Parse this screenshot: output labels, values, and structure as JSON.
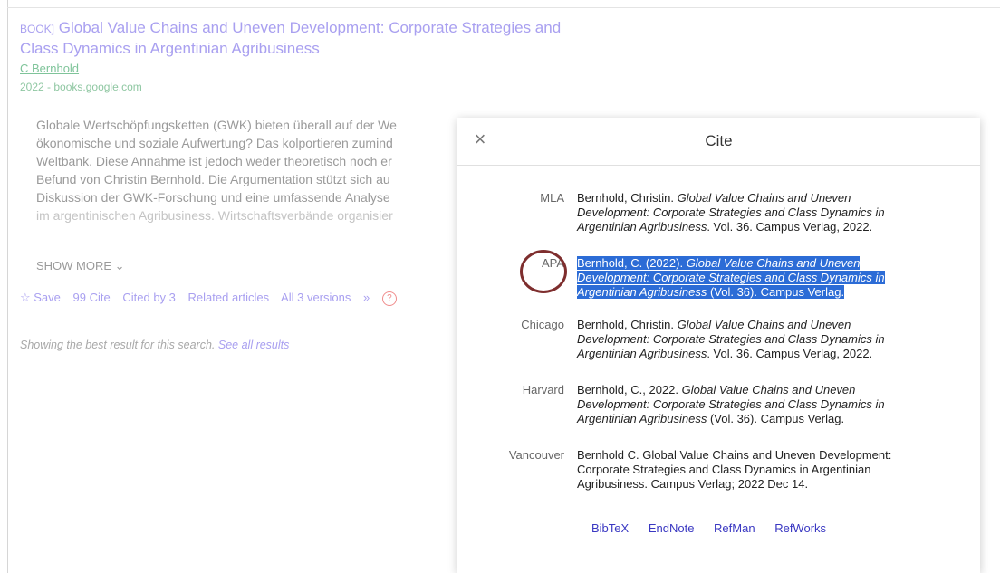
{
  "result": {
    "type_tag": "BOOK]",
    "title_line1": "Global Value Chains and Uneven Development: Corporate Strategies and",
    "title_line2": "Class Dynamics in Argentinian Agribusiness",
    "author": "C Bernhold",
    "meta": "2022 - books.google.com",
    "snippet_lines": [
      "Globale Wertschöpfungsketten (GWK) bieten überall auf der We",
      "ökonomische und soziale Aufwertung? Das kolportieren zumind",
      "Weltbank. Diese Annahme ist jedoch weder theoretisch noch er",
      "Befund von Christin Bernhold. Die Argumentation stützt sich au",
      "Diskussion der GWK-Forschung und eine umfassende Analyse"
    ],
    "snippet_faded": "im argentinischen Agribusiness. Wirtschaftsverbände organisier",
    "show_more": "SHOW MORE ⌄",
    "actions": {
      "save": "☆ Save",
      "cite": "99 Cite",
      "cited_by": "Cited by 3",
      "related": "Related articles",
      "versions": "All 3 versions",
      "more": "»"
    },
    "best_text": "Showing the best result for this search.",
    "best_link": "See all results"
  },
  "dialog": {
    "title": "Cite",
    "close": "×",
    "citations": [
      {
        "style": "MLA"
      },
      {
        "style": "APA"
      },
      {
        "style": "Chicago"
      },
      {
        "style": "Harvard"
      },
      {
        "style": "Vancouver"
      }
    ],
    "mla": {
      "a": "Bernhold, Christin. ",
      "b": "Global Value Chains and Uneven Development: Corporate Strategies and Class Dynamics in Argentinian Agribusiness",
      "c": ". Vol. 36. Campus Verlag, 2022."
    },
    "apa": {
      "a": "Bernhold, C. (2022). ",
      "b": "Global Value Chains and Uneven Development: Corporate Strategies and Class Dynamics in Argentinian Agribusiness",
      "c": " (Vol. 36). Campus Verlag."
    },
    "chicago": {
      "a": "Bernhold, Christin. ",
      "b": "Global Value Chains and Uneven Development: Corporate Strategies and Class Dynamics in Argentinian Agribusiness",
      "c": ". Vol. 36. Campus Verlag, 2022."
    },
    "harvard": {
      "a": "Bernhold, C., 2022. ",
      "b": "Global Value Chains and Uneven Development: Corporate Strategies and Class Dynamics in Argentinian Agribusiness",
      "c": " (Vol. 36). Campus Verlag."
    },
    "vancouver": "Bernhold C. Global Value Chains and Uneven Development: Corporate Strategies and Class Dynamics in Argentinian Agribusiness. Campus Verlag; 2022 Dec 14.",
    "export_links": [
      "BibTeX",
      "EndNote",
      "RefMan",
      "RefWorks"
    ]
  }
}
